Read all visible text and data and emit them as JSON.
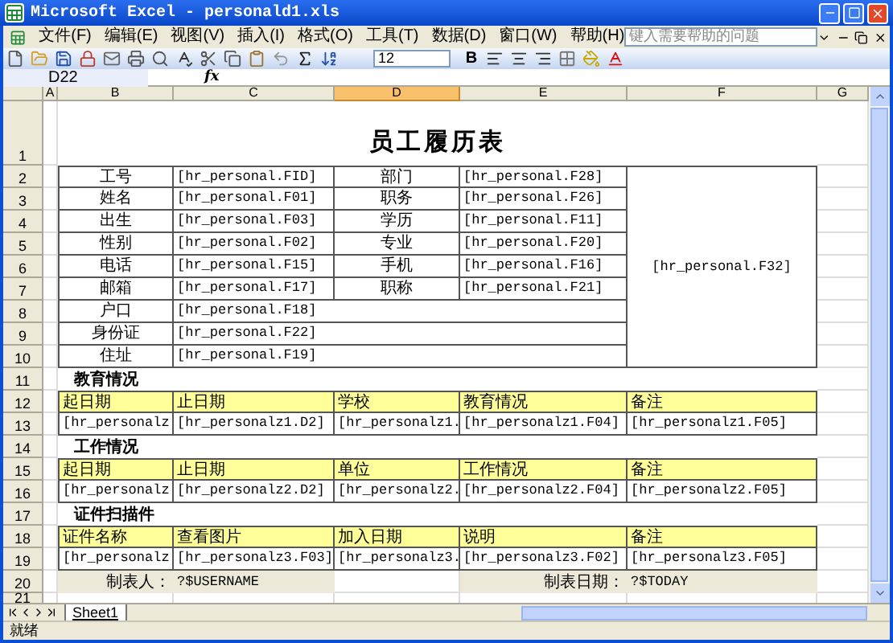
{
  "window": {
    "title": "Microsoft Excel - personald1.xls"
  },
  "menu": [
    "文件(F)",
    "编辑(E)",
    "视图(V)",
    "插入(I)",
    "格式(O)",
    "工具(T)",
    "数据(D)",
    "窗口(W)",
    "帮助(H)"
  ],
  "help_box": {
    "placeholder": "键入需要帮助的问题"
  },
  "toolbar": {
    "font_size": "12",
    "bold_label": "B"
  },
  "formula_bar": {
    "name_box": "D22",
    "function_label": "fx"
  },
  "columns": [
    {
      "label": "A",
      "selected": false
    },
    {
      "label": "B",
      "selected": false
    },
    {
      "label": "C",
      "selected": false
    },
    {
      "label": "D",
      "selected": true
    },
    {
      "label": "E",
      "selected": false
    },
    {
      "label": "F",
      "selected": false
    },
    {
      "label": "G",
      "selected": false
    }
  ],
  "rows": [
    "1",
    "2",
    "3",
    "4",
    "5",
    "6",
    "7",
    "8",
    "9",
    "10",
    "11",
    "12",
    "13",
    "14",
    "15",
    "16",
    "17",
    "18",
    "19",
    "20",
    "21"
  ],
  "grid": [
    {
      "cells": [
        {
          "kind": "title",
          "text": "员工履历表"
        }
      ]
    },
    {
      "cells": [
        {
          "kind": "label",
          "text": "工号"
        },
        {
          "kind": "value",
          "text": "[hr_personal.FID]"
        },
        {
          "kind": "label",
          "text": "部门"
        },
        {
          "kind": "value",
          "text": "[hr_personal.F28]"
        },
        {
          "kind": "photo",
          "text": "[hr_personal.F32]"
        }
      ]
    },
    {
      "cells": [
        {
          "kind": "label",
          "text": "姓名"
        },
        {
          "kind": "value",
          "text": "[hr_personal.F01]"
        },
        {
          "kind": "label",
          "text": "职务"
        },
        {
          "kind": "value",
          "text": "[hr_personal.F26]"
        }
      ]
    },
    {
      "cells": [
        {
          "kind": "label",
          "text": "出生"
        },
        {
          "kind": "value",
          "text": "[hr_personal.F03]"
        },
        {
          "kind": "label",
          "text": "学历"
        },
        {
          "kind": "value",
          "text": "[hr_personal.F11]"
        }
      ]
    },
    {
      "cells": [
        {
          "kind": "label",
          "text": "性别"
        },
        {
          "kind": "value",
          "text": "[hr_personal.F02]"
        },
        {
          "kind": "label",
          "text": "专业"
        },
        {
          "kind": "value",
          "text": "[hr_personal.F20]"
        }
      ]
    },
    {
      "cells": [
        {
          "kind": "label",
          "text": "电话"
        },
        {
          "kind": "value",
          "text": "[hr_personal.F15]"
        },
        {
          "kind": "label",
          "text": "手机"
        },
        {
          "kind": "value",
          "text": "[hr_personal.F16]"
        }
      ]
    },
    {
      "cells": [
        {
          "kind": "label",
          "text": "邮箱"
        },
        {
          "kind": "value",
          "text": "[hr_personal.F17]"
        },
        {
          "kind": "label",
          "text": "职称"
        },
        {
          "kind": "value",
          "text": "[hr_personal.F21]"
        }
      ]
    },
    {
      "cells": [
        {
          "kind": "label",
          "text": "户口"
        },
        {
          "kind": "wide_value",
          "text": "[hr_personal.F18]"
        }
      ]
    },
    {
      "cells": [
        {
          "kind": "label",
          "text": "身份证"
        },
        {
          "kind": "wide_value",
          "text": "[hr_personal.F22]"
        }
      ]
    },
    {
      "cells": [
        {
          "kind": "label",
          "text": "住址"
        },
        {
          "kind": "wide_value",
          "text": "[hr_personal.F19]"
        }
      ]
    },
    {
      "cells": [
        {
          "kind": "section",
          "text": "教育情况"
        }
      ]
    },
    {
      "cells": [
        {
          "kind": "header",
          "text": "起日期"
        },
        {
          "kind": "header",
          "text": "止日期"
        },
        {
          "kind": "header",
          "text": "学校"
        },
        {
          "kind": "header",
          "text": "教育情况"
        },
        {
          "kind": "header",
          "text": "备注"
        }
      ]
    },
    {
      "cells": [
        {
          "kind": "value",
          "text": "[hr_personalz"
        },
        {
          "kind": "value",
          "text": "[hr_personalz1.D2]"
        },
        {
          "kind": "value",
          "text": "[hr_personalz1."
        },
        {
          "kind": "value",
          "text": "[hr_personalz1.F04]"
        },
        {
          "kind": "value",
          "text": "[hr_personalz1.F05]"
        }
      ]
    },
    {
      "cells": [
        {
          "kind": "section",
          "text": "工作情况"
        }
      ]
    },
    {
      "cells": [
        {
          "kind": "header",
          "text": "起日期"
        },
        {
          "kind": "header",
          "text": "止日期"
        },
        {
          "kind": "header",
          "text": "单位"
        },
        {
          "kind": "header",
          "text": "工作情况"
        },
        {
          "kind": "header",
          "text": "备注"
        }
      ]
    },
    {
      "cells": [
        {
          "kind": "value",
          "text": "[hr_personalz"
        },
        {
          "kind": "value",
          "text": "[hr_personalz2.D2]"
        },
        {
          "kind": "value",
          "text": "[hr_personalz2."
        },
        {
          "kind": "value",
          "text": "[hr_personalz2.F04]"
        },
        {
          "kind": "value",
          "text": "[hr_personalz2.F05]"
        }
      ]
    },
    {
      "cells": [
        {
          "kind": "section",
          "text": "证件扫描件"
        }
      ]
    },
    {
      "cells": [
        {
          "kind": "header",
          "text": "证件名称"
        },
        {
          "kind": "header",
          "text": "查看图片"
        },
        {
          "kind": "header",
          "text": "加入日期"
        },
        {
          "kind": "header",
          "text": "说明"
        },
        {
          "kind": "header",
          "text": "备注"
        }
      ]
    },
    {
      "cells": [
        {
          "kind": "value",
          "text": "[hr_personalz"
        },
        {
          "kind": "value",
          "text": "[hr_personalz3.F03]"
        },
        {
          "kind": "value",
          "text": "[hr_personalz3."
        },
        {
          "kind": "value",
          "text": "[hr_personalz3.F02]"
        },
        {
          "kind": "value",
          "text": "[hr_personalz3.F05]"
        }
      ]
    },
    {
      "cells": [
        {
          "kind": "footer_label",
          "text": "制表人："
        },
        {
          "kind": "footer_value",
          "text": "?$USERNAME"
        },
        {
          "kind": "blank"
        },
        {
          "kind": "footer_label",
          "text": "制表日期："
        },
        {
          "kind": "footer_value",
          "text": "?$TODAY"
        }
      ]
    }
  ],
  "sheet_tabs": [
    {
      "label": "Sheet1",
      "selected": true
    }
  ],
  "status_bar": "就绪"
}
